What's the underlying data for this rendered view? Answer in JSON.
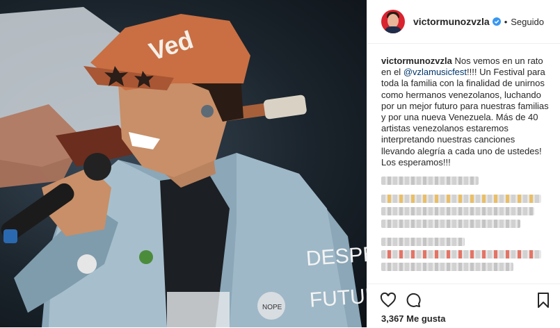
{
  "post": {
    "username": "victormunozvzla",
    "follow_status": "Seguido",
    "dot": "•",
    "caption": {
      "user": "victormunozvzla",
      "text_start": " Nos vemos en un rato en el ",
      "mention": "@vzlamusicfest",
      "text_end": "!!!! Un Festival para toda la familia con la finalidad de unirnos como hermanos venezolanos, luchando por un mejor futuro para nuestras familias y por una nueva Venezuela. Más de 40 artistas venezolanos estaremos interpretando nuestras canciones llevando alegría a cada uno de ustedes! Los esperamos!!!"
    },
    "likes": "3,367 Me gusta",
    "icons": [
      "heart-icon",
      "comment-icon",
      "bookmark-icon",
      "verified-badge-icon"
    ],
    "photo_text": {
      "cap": "Ved",
      "jacket_1": "DESPE",
      "jacket_2": "FUTUR",
      "patch": "NOPE"
    }
  }
}
